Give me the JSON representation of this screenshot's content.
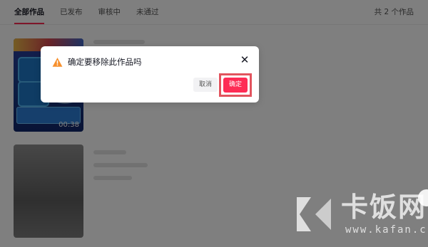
{
  "tabs": [
    {
      "label": "全部作品"
    },
    {
      "label": "已发布"
    },
    {
      "label": "审核中"
    },
    {
      "label": "未通过"
    }
  ],
  "works_count": "共 2 个作品",
  "works": [
    {
      "duration": "00:38"
    }
  ],
  "dialog": {
    "title": "确定要移除此作品吗",
    "close_symbol": "✕",
    "cancel_label": "取消",
    "confirm_label": "确定"
  },
  "watermark": {
    "brand": "卡饭网",
    "url": "www.kafan.cn"
  },
  "colors": {
    "accent": "#fe2c55",
    "warning": "#f7902d",
    "highlight_border": "#e2545e"
  },
  "icons": {
    "warning": "warning-icon",
    "close": "close-icon"
  }
}
